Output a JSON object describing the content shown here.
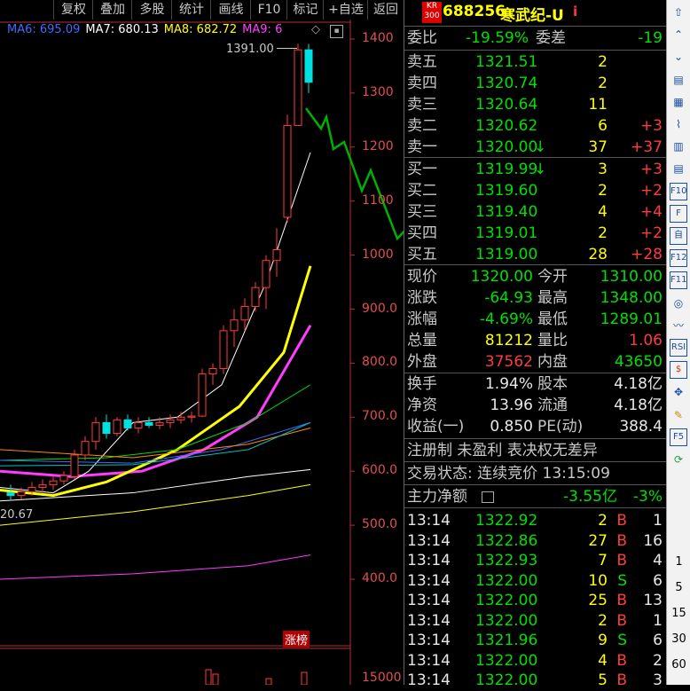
{
  "toolbar": {
    "buttons": [
      "复权",
      "叠加",
      "多股",
      "统计",
      "画线",
      "F10",
      "标记",
      "+自选",
      "返回"
    ]
  },
  "ma_legend": [
    {
      "label": "MA6: 695.09",
      "color": "#3b6cff"
    },
    {
      "label": "MA7: 680.13",
      "color": "#ffffff"
    },
    {
      "label": "MA8: 682.72",
      "color": "#ffff00"
    },
    {
      "label": "MA9: 6",
      "color": "#ff40ff"
    }
  ],
  "chart": {
    "y_ticks": [
      "1400",
      "1300",
      "1200",
      "1100",
      "1000",
      "900.0",
      "800.0",
      "700.0",
      "600.0",
      "500.0",
      "400.0"
    ],
    "high_label": "1391.00",
    "low_label": "20.67",
    "tag_label": "涨榜",
    "volume_tick": "15000"
  },
  "chart_data": {
    "type": "candlestick",
    "y_axis_ticks": [
      1400,
      1300,
      1200,
      1100,
      1000,
      900,
      800,
      700,
      600,
      500,
      400
    ],
    "ylim": [
      380,
      1420
    ],
    "annotations": [
      "1391.00",
      "20.67",
      "涨榜"
    ],
    "series": [
      {
        "name": "MA6",
        "last": 695.09
      },
      {
        "name": "MA7",
        "last": 680.13
      },
      {
        "name": "MA8",
        "last": 682.72
      }
    ],
    "candles": [
      {
        "o": 560,
        "h": 575,
        "l": 545,
        "c": 555
      },
      {
        "o": 555,
        "h": 570,
        "l": 548,
        "c": 562
      },
      {
        "o": 562,
        "h": 580,
        "l": 555,
        "c": 570
      },
      {
        "o": 570,
        "h": 585,
        "l": 560,
        "c": 575
      },
      {
        "o": 575,
        "h": 590,
        "l": 565,
        "c": 582
      },
      {
        "o": 582,
        "h": 600,
        "l": 575,
        "c": 592
      },
      {
        "o": 590,
        "h": 640,
        "l": 585,
        "c": 630
      },
      {
        "o": 630,
        "h": 665,
        "l": 620,
        "c": 655
      },
      {
        "o": 655,
        "h": 700,
        "l": 640,
        "c": 690
      },
      {
        "o": 690,
        "h": 705,
        "l": 660,
        "c": 670
      },
      {
        "o": 670,
        "h": 700,
        "l": 665,
        "c": 695
      },
      {
        "o": 695,
        "h": 705,
        "l": 675,
        "c": 680
      },
      {
        "o": 680,
        "h": 700,
        "l": 670,
        "c": 690
      },
      {
        "o": 690,
        "h": 700,
        "l": 680,
        "c": 685
      },
      {
        "o": 685,
        "h": 700,
        "l": 678,
        "c": 690
      },
      {
        "o": 690,
        "h": 705,
        "l": 680,
        "c": 695
      },
      {
        "o": 695,
        "h": 710,
        "l": 688,
        "c": 700
      },
      {
        "o": 700,
        "h": 710,
        "l": 690,
        "c": 702
      },
      {
        "o": 702,
        "h": 790,
        "l": 700,
        "c": 780
      },
      {
        "o": 780,
        "h": 800,
        "l": 760,
        "c": 790
      },
      {
        "o": 790,
        "h": 870,
        "l": 780,
        "c": 860
      },
      {
        "o": 860,
        "h": 900,
        "l": 830,
        "c": 880
      },
      {
        "o": 880,
        "h": 920,
        "l": 860,
        "c": 905
      },
      {
        "o": 905,
        "h": 950,
        "l": 895,
        "c": 940
      },
      {
        "o": 940,
        "h": 1000,
        "l": 900,
        "c": 990
      },
      {
        "o": 990,
        "h": 1050,
        "l": 960,
        "c": 1010
      },
      {
        "o": 1070,
        "h": 1260,
        "l": 1060,
        "c": 1240
      },
      {
        "o": 1240,
        "h": 1391,
        "l": 1300,
        "c": 1380
      },
      {
        "o": 1380,
        "h": 1391,
        "l": 1300,
        "c": 1320
      }
    ]
  },
  "quote": {
    "badge_top": "KR",
    "badge_bottom": "300",
    "code": "688256",
    "name": "寒武纪-U",
    "info_icon": "i",
    "webi": {
      "label": "委比",
      "value": "-19.59%",
      "label2": "委差",
      "value2": "-19"
    },
    "asks": [
      {
        "label": "卖五",
        "price": "1321.51",
        "vol": "2",
        "chg": ""
      },
      {
        "label": "卖四",
        "price": "1320.74",
        "vol": "2",
        "chg": ""
      },
      {
        "label": "卖三",
        "price": "1320.64",
        "vol": "11",
        "chg": ""
      },
      {
        "label": "卖二",
        "price": "1320.62",
        "vol": "6",
        "chg": "+3"
      },
      {
        "label": "卖一",
        "price": "1320.00",
        "arrow": "↓",
        "vol": "37",
        "chg": "+37"
      }
    ],
    "bids": [
      {
        "label": "买一",
        "price": "1319.99",
        "arrow": "↓",
        "vol": "3",
        "chg": "+3"
      },
      {
        "label": "买二",
        "price": "1319.60",
        "vol": "2",
        "chg": "+2"
      },
      {
        "label": "买三",
        "price": "1319.40",
        "vol": "4",
        "chg": "+4"
      },
      {
        "label": "买四",
        "price": "1319.01",
        "vol": "2",
        "chg": "+2"
      },
      {
        "label": "买五",
        "price": "1319.00",
        "vol": "28",
        "chg": "+28"
      }
    ],
    "stats": [
      {
        "l1": "现价",
        "v1": "1320.00",
        "l2": "今开",
        "v2": "1310.00",
        "c1": "green",
        "c2": "green"
      },
      {
        "l1": "涨跌",
        "v1": "-64.93",
        "l2": "最高",
        "v2": "1348.00",
        "c1": "green",
        "c2": "green"
      },
      {
        "l1": "涨幅",
        "v1": "-4.69%",
        "l2": "最低",
        "v2": "1289.01",
        "c1": "green",
        "c2": "green"
      },
      {
        "l1": "总量",
        "v1": "81212",
        "l2": "量比",
        "v2": "1.06",
        "c1": "yellow",
        "c2": "red"
      },
      {
        "l1": "外盘",
        "v1": "37562",
        "l2": "内盘",
        "v2": "43650",
        "c1": "red",
        "c2": "green"
      }
    ],
    "fund": [
      {
        "l1": "换手",
        "v1": "1.94%",
        "l2": "股本",
        "v2": "4.18亿"
      },
      {
        "l1": "净资",
        "v1": "13.96",
        "l2": "流通",
        "v2": "4.18亿"
      },
      {
        "l1": "收益(一)",
        "v1": "0.850",
        "l2": "PE(动)",
        "v2": "388.4"
      }
    ],
    "reg_line": "注册制 未盈利 表决权无差异",
    "status_line": "交易状态: 连续竞价 13:15:09",
    "main_net": {
      "label": "主力净额",
      "value": "-3.55亿",
      "pct": "-3%"
    },
    "trades": [
      {
        "t": "13:14",
        "p": "1322.92",
        "v": "2",
        "s": "B",
        "n": "1"
      },
      {
        "t": "13:14",
        "p": "1322.86",
        "v": "27",
        "s": "B",
        "n": "16"
      },
      {
        "t": "13:14",
        "p": "1322.93",
        "v": "7",
        "s": "B",
        "n": "4"
      },
      {
        "t": "13:14",
        "p": "1322.00",
        "v": "10",
        "s": "S",
        "n": "6"
      },
      {
        "t": "13:14",
        "p": "1322.00",
        "v": "25",
        "s": "B",
        "n": "13"
      },
      {
        "t": "13:14",
        "p": "1322.00",
        "v": "2",
        "s": "B",
        "n": "1"
      },
      {
        "t": "13:14",
        "p": "1321.96",
        "v": "9",
        "s": "S",
        "n": "6"
      },
      {
        "t": "13:14",
        "p": "1322.00",
        "v": "4",
        "s": "B",
        "n": "2"
      },
      {
        "t": "13:14",
        "p": "1322.00",
        "v": "5",
        "s": "B",
        "n": "3"
      }
    ]
  },
  "right_toolbar": {
    "icons": [
      "up-arrow-icon",
      "chevron-up-icon",
      "chevron-down-icon",
      "book-icon",
      "table-icon",
      "chart-line-icon",
      "candlestick-icon",
      "list-icon",
      "f10-icon",
      "f10-alt-icon",
      "self-select-icon",
      "f12-icon",
      "f11-icon",
      "circle-icon",
      "wave-icon",
      "rsi-icon",
      "dollar-icon",
      "move-icon",
      "pen-icon",
      "f5-icon",
      "refresh-icon"
    ],
    "icon_text": [
      "",
      "",
      "",
      "",
      "",
      "",
      "",
      "",
      "F10",
      "F",
      "自",
      "F12",
      "F11",
      "",
      "",
      "RSI",
      "$",
      "",
      "",
      "F5",
      ""
    ],
    "periods": [
      "1",
      "5",
      "15",
      "30",
      "60"
    ]
  }
}
